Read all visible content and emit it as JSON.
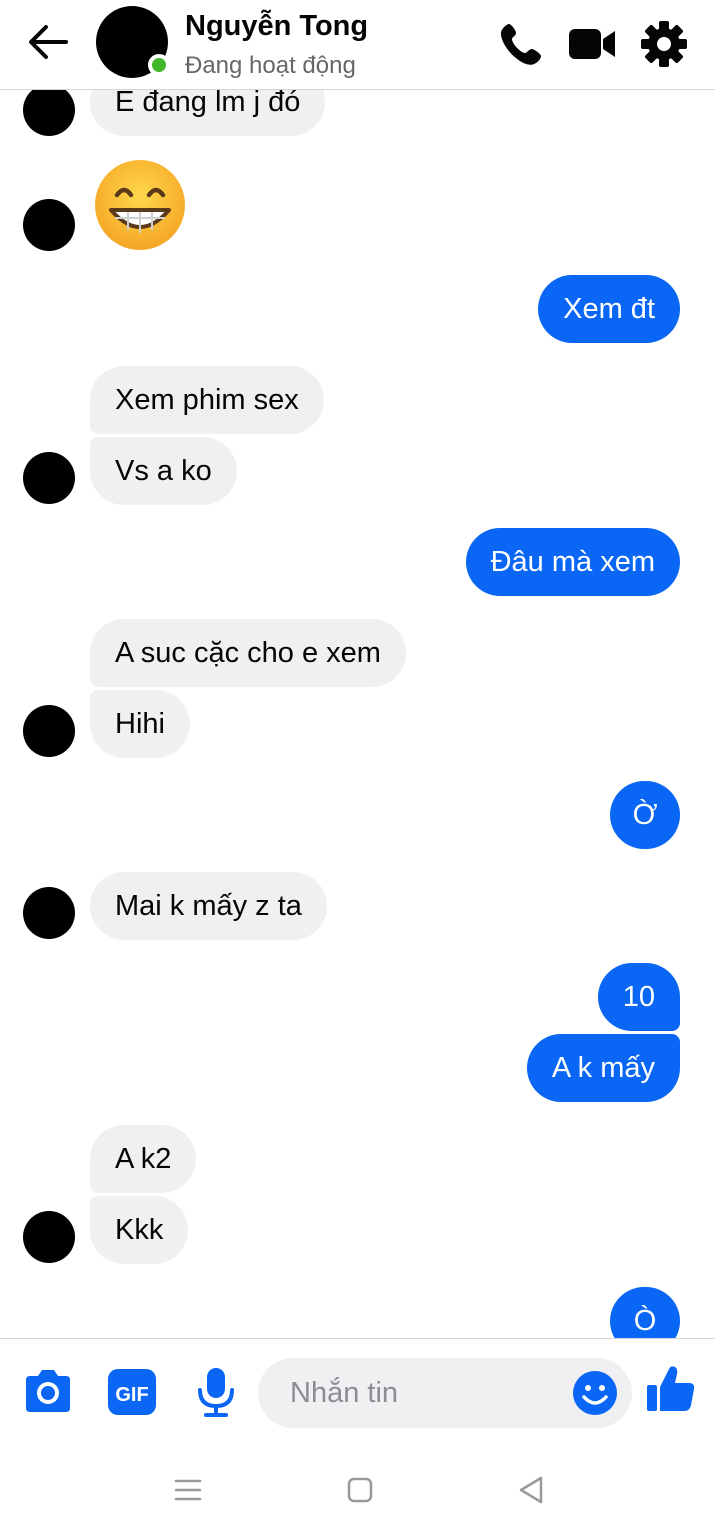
{
  "header": {
    "contact_name": "Nguyễn Tong",
    "status": "Đang hoạt động",
    "icons": [
      "back-arrow-icon",
      "phone-icon",
      "video-camera-icon",
      "gear-icon"
    ]
  },
  "messages": [
    {
      "side": "in",
      "text": "E đang lm j đó"
    },
    {
      "side": "in",
      "emoji": "beaming-face-with-smiling-eyes"
    },
    {
      "side": "out",
      "text": "Xem đt"
    },
    {
      "side": "in",
      "text": "Xem phim sex"
    },
    {
      "side": "in",
      "text": "Vs a ko"
    },
    {
      "side": "out",
      "text": "Đâu mà xem"
    },
    {
      "side": "in",
      "text": "A suc cặc cho e xem"
    },
    {
      "side": "in",
      "text": "Hihi"
    },
    {
      "side": "out",
      "text": "Ờ"
    },
    {
      "side": "in",
      "text": "Mai k mấy z ta"
    },
    {
      "side": "out",
      "text": "10"
    },
    {
      "side": "out",
      "text": "A k mấy"
    },
    {
      "side": "in",
      "text": "A k2"
    },
    {
      "side": "in",
      "text": "Kkk"
    },
    {
      "side": "out",
      "text": "Ò"
    }
  ],
  "composer": {
    "placeholder": "Nhắn tin",
    "gif_label": "GIF",
    "icons": [
      "camera-icon",
      "gif-icon",
      "microphone-icon",
      "emoji-icon",
      "thumbs-up-icon"
    ]
  },
  "colors": {
    "accent": "#0a66f5",
    "incoming_bubble": "#f0f0f2",
    "online": "#42b72a"
  }
}
